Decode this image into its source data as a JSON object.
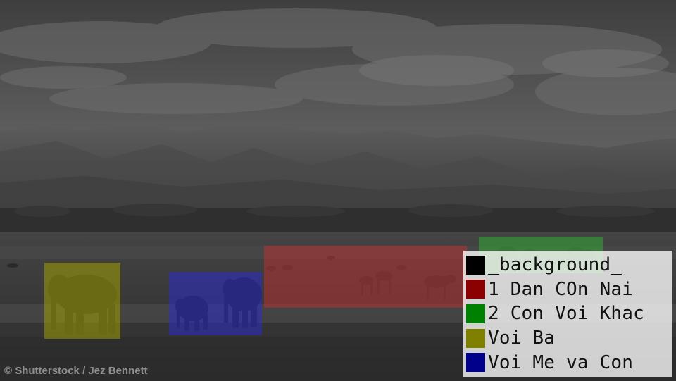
{
  "colors": {
    "background": "#000000",
    "dan_con_nai": "#8b0000",
    "con_voi_khac": "#008000",
    "voi_ba": "#808000",
    "voi_me_va_con": "#00008b"
  },
  "legend": {
    "items": [
      {
        "label": "_background_",
        "color": "#000000"
      },
      {
        "label": "1 Dan COn Nai",
        "color": "#8b0000"
      },
      {
        "label": "2 Con Voi Khac",
        "color": "#008000"
      },
      {
        "label": "Voi Ba",
        "color": "#808000"
      },
      {
        "label": "Voi Me va Con",
        "color": "#00008b"
      }
    ]
  },
  "watermark": "© Shutterstock / Jez Bennett"
}
